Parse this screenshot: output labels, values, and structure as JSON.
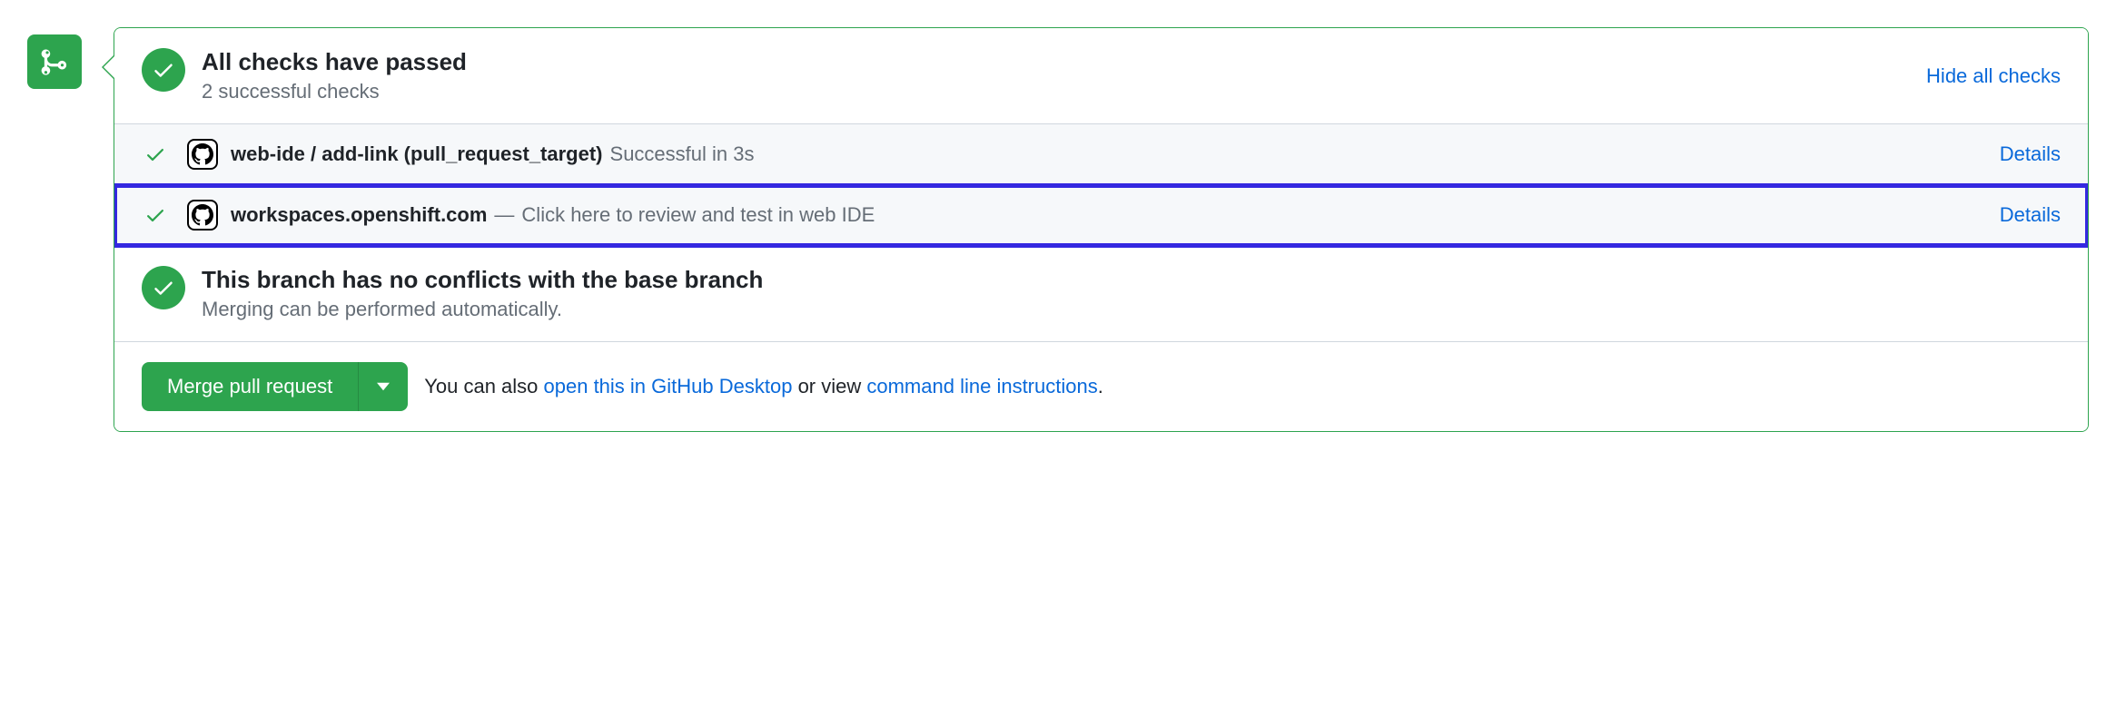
{
  "checks_summary": {
    "title": "All checks have passed",
    "subtitle": "2 successful checks",
    "toggle_link": "Hide all checks"
  },
  "checks": [
    {
      "name": "web-ide / add-link (pull_request_target)",
      "separator": "",
      "description": "Successful in 3s",
      "details_label": "Details"
    },
    {
      "name": "workspaces.openshift.com",
      "separator": " — ",
      "description": "Click here to review and test in web IDE",
      "details_label": "Details"
    }
  ],
  "conflicts": {
    "title": "This branch has no conflicts with the base branch",
    "subtitle": "Merging can be performed automatically."
  },
  "merge": {
    "button_label": "Merge pull request",
    "hint_prefix": "You can also ",
    "hint_link1": "open this in GitHub Desktop",
    "hint_middle": " or view ",
    "hint_link2": "command line instructions",
    "hint_suffix": "."
  }
}
